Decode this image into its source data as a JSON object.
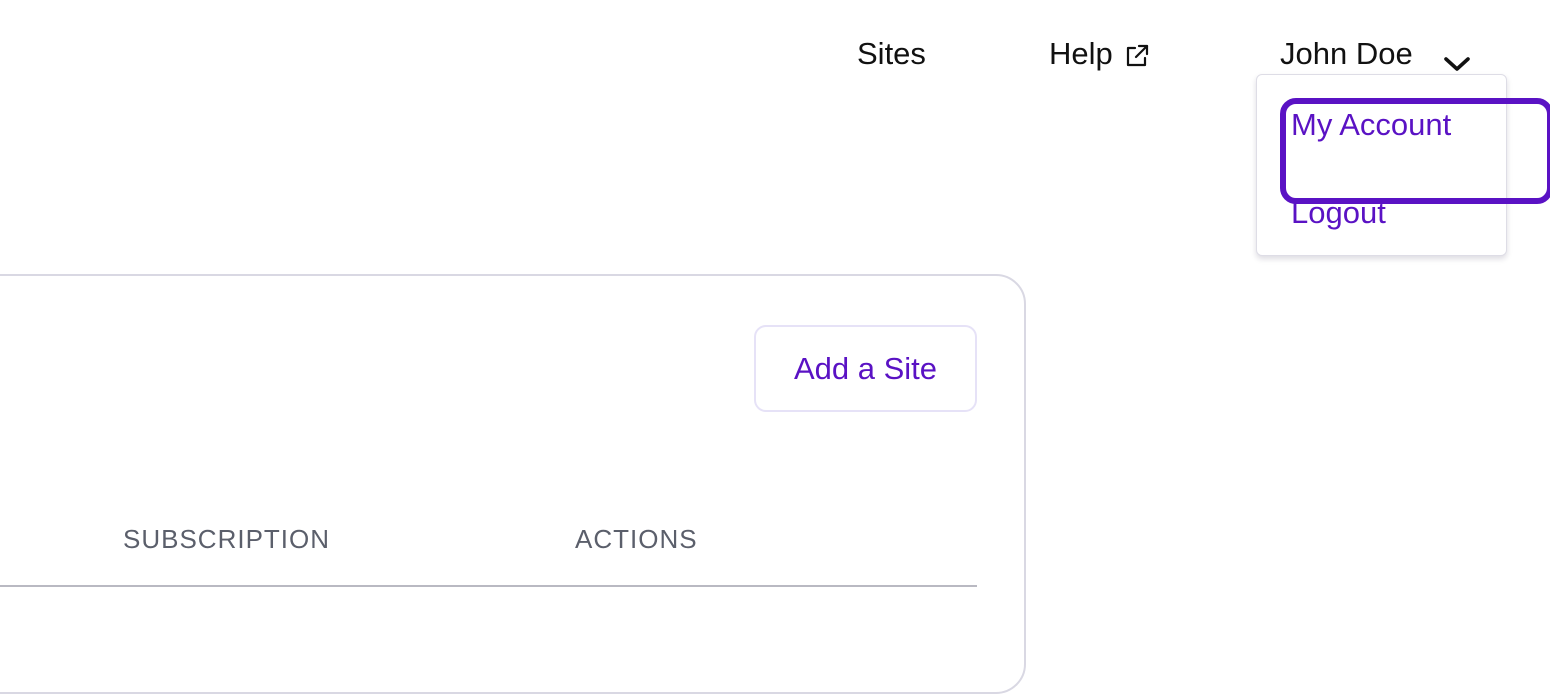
{
  "nav": {
    "sites_label": "Sites",
    "help_label": "Help",
    "help_icon": "external-link-icon",
    "user_name": "John Doe",
    "user_icon": "chevron-down-icon"
  },
  "user_menu": {
    "items": [
      {
        "label": "My Account",
        "focused": true
      },
      {
        "label": "Logout",
        "focused": false
      }
    ]
  },
  "sites_card": {
    "add_site_label": "Add a Site",
    "table": {
      "columns": [
        "SUBSCRIPTION",
        "ACTIONS"
      ]
    }
  },
  "colors": {
    "accent": "#5a12c4",
    "text": "#111111",
    "muted_header": "#5b5f6b",
    "border": "#d9d8e3"
  }
}
